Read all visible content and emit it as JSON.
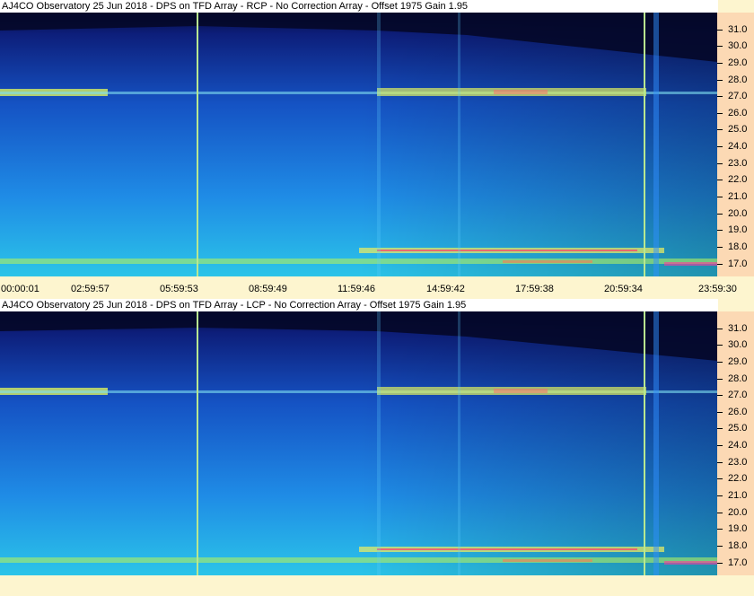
{
  "panels": [
    {
      "title": "AJ4CO Observatory 25 Jun 2018 - DPS on TFD Array   - RCP  -  No Correction Array  -  Offset 1975  Gain 1.95",
      "polarization": "RCP"
    },
    {
      "title": "AJ4CO Observatory 25 Jun 2018 - DPS on TFD Array   - LCP  -  No Correction Array  -  Offset 1975  Gain 1.95",
      "polarization": "LCP"
    }
  ],
  "frequency_labels": [
    "31.0",
    "30.0",
    "29.0",
    "28.0",
    "27.0",
    "26.0",
    "25.0",
    "24.0",
    "23.0",
    "22.0",
    "21.0",
    "20.0",
    "19.0",
    "18.0",
    "17.0"
  ],
  "time_labels": [
    "00:00:01",
    "02:59:57",
    "05:59:53",
    "08:59:49",
    "11:59:46",
    "14:59:42",
    "17:59:38",
    "20:59:34",
    "23:59:30"
  ],
  "colors": {
    "background": "#fdf5cf",
    "scale_panel": "#fcd9b4",
    "spectrogram_low": "#0a1a6e",
    "spectrogram_mid": "#1f6fd8",
    "spectrogram_high": "#30d8e8",
    "band_yellow": "#e8f060",
    "band_red": "#ff3a6a"
  }
}
